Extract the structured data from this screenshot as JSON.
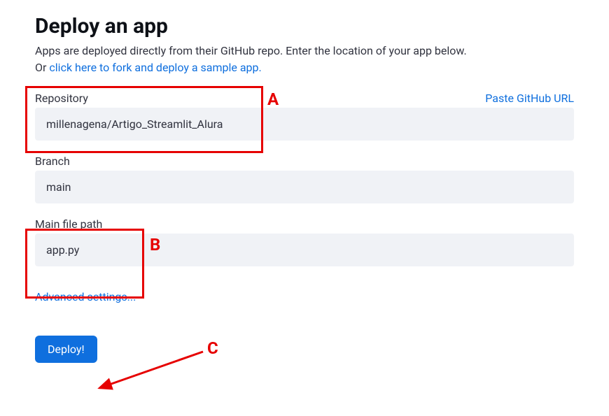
{
  "page": {
    "title": "Deploy an app",
    "subtitle_plain": "Apps are deployed directly from their GitHub repo. Enter the location of your app below.",
    "subtitle_prefix": "Or ",
    "subtitle_link": "click here to fork and deploy a sample app."
  },
  "fields": {
    "repository": {
      "label": "Repository",
      "value": "millenagena/Artigo_Streamlit_Alura",
      "paste_link": "Paste GitHub URL"
    },
    "branch": {
      "label": "Branch",
      "value": "main"
    },
    "main_file": {
      "label": "Main file path",
      "value": "app.py"
    }
  },
  "advanced_link": "Advanced settings...",
  "deploy_button": "Deploy!",
  "annotations": {
    "a": "A",
    "b": "B",
    "c": "C"
  }
}
